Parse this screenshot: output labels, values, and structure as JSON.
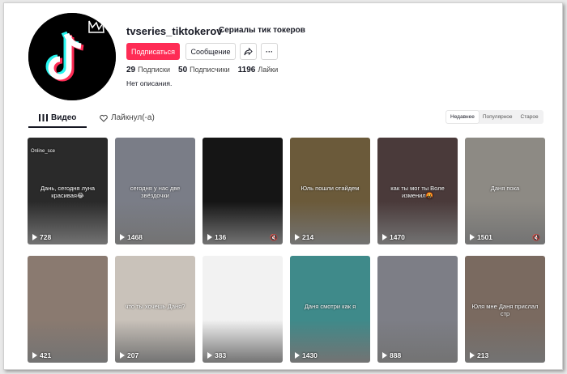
{
  "profile": {
    "username": "tvseries_tiktokerov",
    "nickname": "Сериалы тик токеров",
    "follow_label": "Подписаться",
    "message_label": "Сообщение",
    "share_icon": "share-icon",
    "more_label": "···",
    "following_count": "29",
    "following_label": "Подписки",
    "followers_count": "50",
    "followers_label": "Подписчики",
    "likes_count": "1196",
    "likes_label": "Лайки",
    "bio": "Нет описания."
  },
  "tabs": {
    "videos": "Видео",
    "liked": "Лайкнул(-а)"
  },
  "sort": {
    "new": "Недавнее",
    "popular": "Популярное",
    "old": "Старое"
  },
  "videos": [
    {
      "views": "728",
      "caption": "Дань, сегодня луна красивая😂",
      "top": "Online_sce",
      "color": "#2a2a2a"
    },
    {
      "views": "1468",
      "caption": "сегодня у нас две звёздочки",
      "color": "#7a7d87"
    },
    {
      "views": "136",
      "caption": "",
      "color": "#151515"
    },
    {
      "views": "214",
      "caption": "Юль пошли отайдем",
      "color": "#6b5a3a"
    },
    {
      "views": "1470",
      "caption": "как ты мог ты Воле изменил🤬",
      "color": "#4a3a3a"
    },
    {
      "views": "1501",
      "caption": "Даня пока",
      "color": "#8d8a84"
    },
    {
      "views": "421",
      "caption": "",
      "color": "#8a7a70"
    },
    {
      "views": "207",
      "caption": "что ты хочешь Даня?",
      "color": "#c9c2ba"
    },
    {
      "views": "383",
      "caption": "",
      "color": "#f2f2f2"
    },
    {
      "views": "1430",
      "caption": "Даня смотри как я",
      "color": "#3f8a8a"
    },
    {
      "views": "888",
      "caption": "",
      "color": "#7d7e86"
    },
    {
      "views": "213",
      "caption": "Юля мне Даня прислал стр",
      "color": "#7a6a60"
    }
  ]
}
